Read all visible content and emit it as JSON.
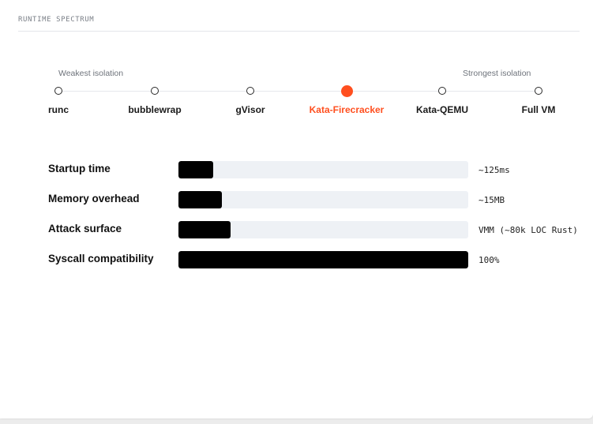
{
  "section_title": "RUNTIME SPECTRUM",
  "spectrum": {
    "weakest_label": "Weakest isolation",
    "strongest_label": "Strongest isolation",
    "active_color": "#ff4f1f",
    "runtimes": [
      {
        "label": "runc",
        "active": false
      },
      {
        "label": "bubblewrap",
        "active": false
      },
      {
        "label": "gVisor",
        "active": false
      },
      {
        "label": "Kata-Firecracker",
        "active": true
      },
      {
        "label": "Kata-QEMU",
        "active": false
      },
      {
        "label": "Full VM",
        "active": false
      }
    ]
  },
  "metrics": {
    "fill_color": "#000000",
    "track_color": "#eef1f5",
    "items": [
      {
        "label": "Startup time",
        "value": "~125ms",
        "fill": 0.12
      },
      {
        "label": "Memory overhead",
        "value": "~15MB",
        "fill": 0.15
      },
      {
        "label": "Attack surface",
        "value": "VMM (~80k LOC Rust)",
        "fill": 0.18
      },
      {
        "label": "Syscall compatibility",
        "value": "100%",
        "fill": 1.0
      }
    ]
  }
}
